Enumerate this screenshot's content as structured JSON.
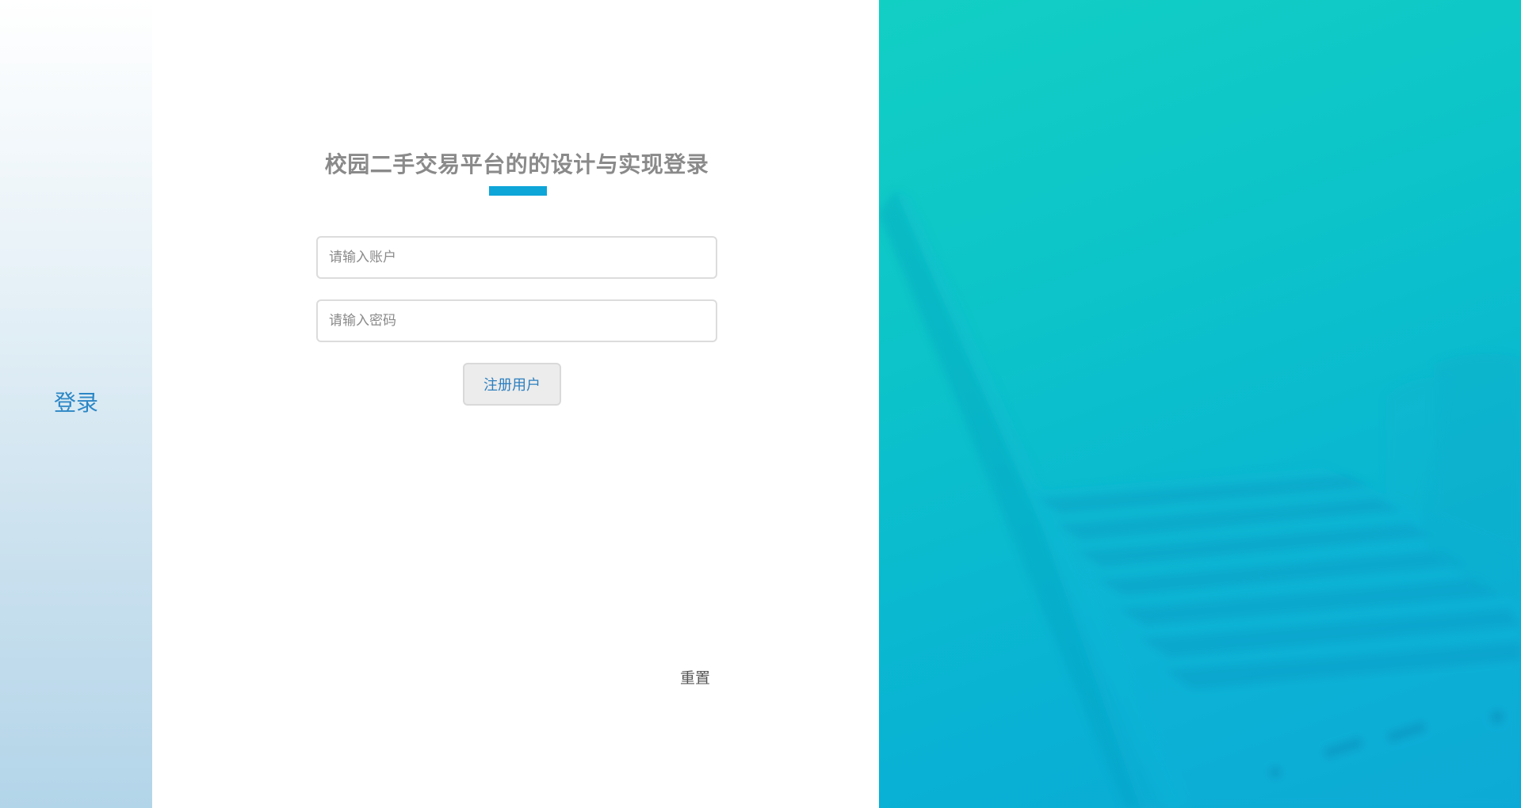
{
  "sidebar": {
    "login_label": "登录"
  },
  "form": {
    "title": "校园二手交易平台的的设计与实现登录",
    "account_placeholder": "请输入账户",
    "password_placeholder": "请输入密码",
    "register_label": "注册用户",
    "reset_label": "重置"
  },
  "colors": {
    "accent": "#0ea5d9",
    "link_blue": "#2b86c5",
    "hero_teal": "#0cc4c9"
  },
  "hero": {
    "icon": "laptop-typing-image"
  }
}
